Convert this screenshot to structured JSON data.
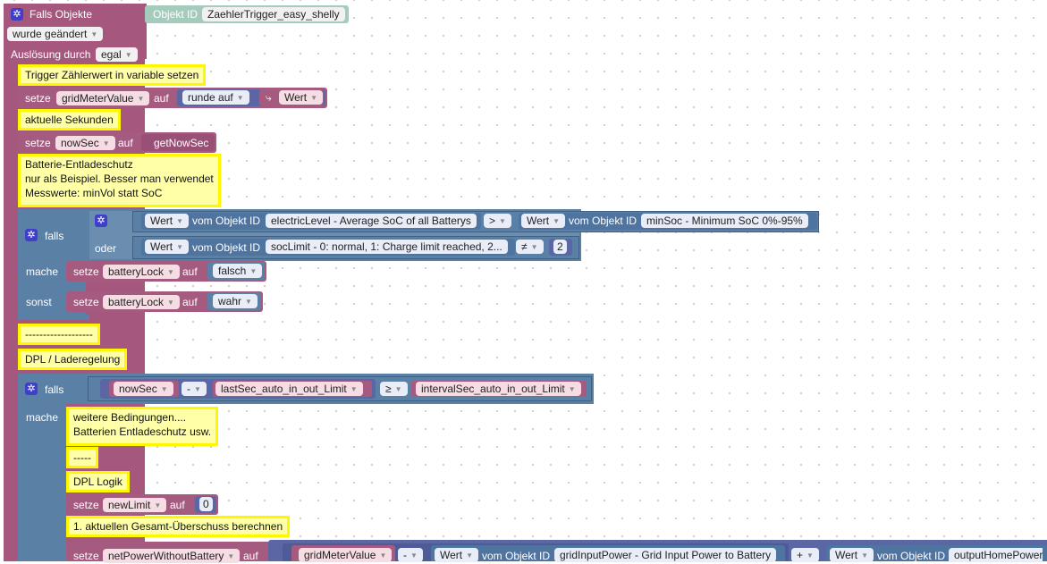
{
  "trigger": {
    "title": "Falls Objekte",
    "objekt_id_label": "Objekt ID",
    "objekt_id_value": "ZaehlerTrigger_easy_shelly",
    "wurde_label": "wurde geändert",
    "ausloesung_label": "Auslösung durch",
    "ausloesung_value": "egal"
  },
  "comments": {
    "c1": "Trigger Zählerwert in variable setzen",
    "c2": "aktuelle Sekunden",
    "c3_l1": "Batterie-Entladeschutz",
    "c3_l2": "nur als Beispiel. Besser man verwendet",
    "c3_l3": "Messwerte: minVol statt SoC",
    "c4": "-------------------",
    "c5": "DPL / Laderegelung",
    "c6_l1": "weitere Bedingungen....",
    "c6_l2": "Batterien Entladeschutz usw.",
    "c7": "-----",
    "c8": "DPL Logik",
    "c9": "1. aktuellen Gesamt-Überschuss berechnen"
  },
  "labels": {
    "setze": "setze",
    "auf": "auf",
    "falls": "falls",
    "oder": "oder",
    "mache": "mache",
    "sonst": "sonst",
    "vom_objekt_id": "vom Objekt ID",
    "runde_auf": "runde auf",
    "wert": "Wert",
    "get_now_sec": "getNowSec"
  },
  "vars": {
    "grid_meter_value": "gridMeterValue",
    "now_sec": "nowSec",
    "battery_lock": "batteryLock",
    "last_sec": "lastSec_auto_in_out_Limit",
    "interval_sec": "intervalSec_auto_in_out_Limit",
    "new_limit": "newLimit",
    "net_power": "netPowerWithoutBattery"
  },
  "values": {
    "falsch": "falsch",
    "wahr": "wahr",
    "two": "2",
    "zero": "0"
  },
  "operators": {
    "gt": ">",
    "neq": "≠",
    "minus": "-",
    "gte": "≥",
    "plus": "+"
  },
  "objects": {
    "electric_level": "electricLevel - Average SoC of all Batterys",
    "min_soc": "minSoc - Minimum SoC 0%-95%",
    "soc_limit": "socLimit - 0: normal, 1: Charge limit reached, 2...",
    "grid_input": "gridInputPower - Grid Input Power to Battery",
    "output_home": "outputHomePower"
  },
  "icons": {
    "gear": "gear-icon",
    "arrow": "return-arrow-icon",
    "dropdown": "dropdown-arrow-icon"
  },
  "colors": {
    "trigger_block": "#a5577e",
    "logic_block": "#5b80a5",
    "variable_block": "#a55b80",
    "math_block": "#5b67a5",
    "comment_bg": "#ffffa8",
    "comment_border": "#fff700"
  }
}
